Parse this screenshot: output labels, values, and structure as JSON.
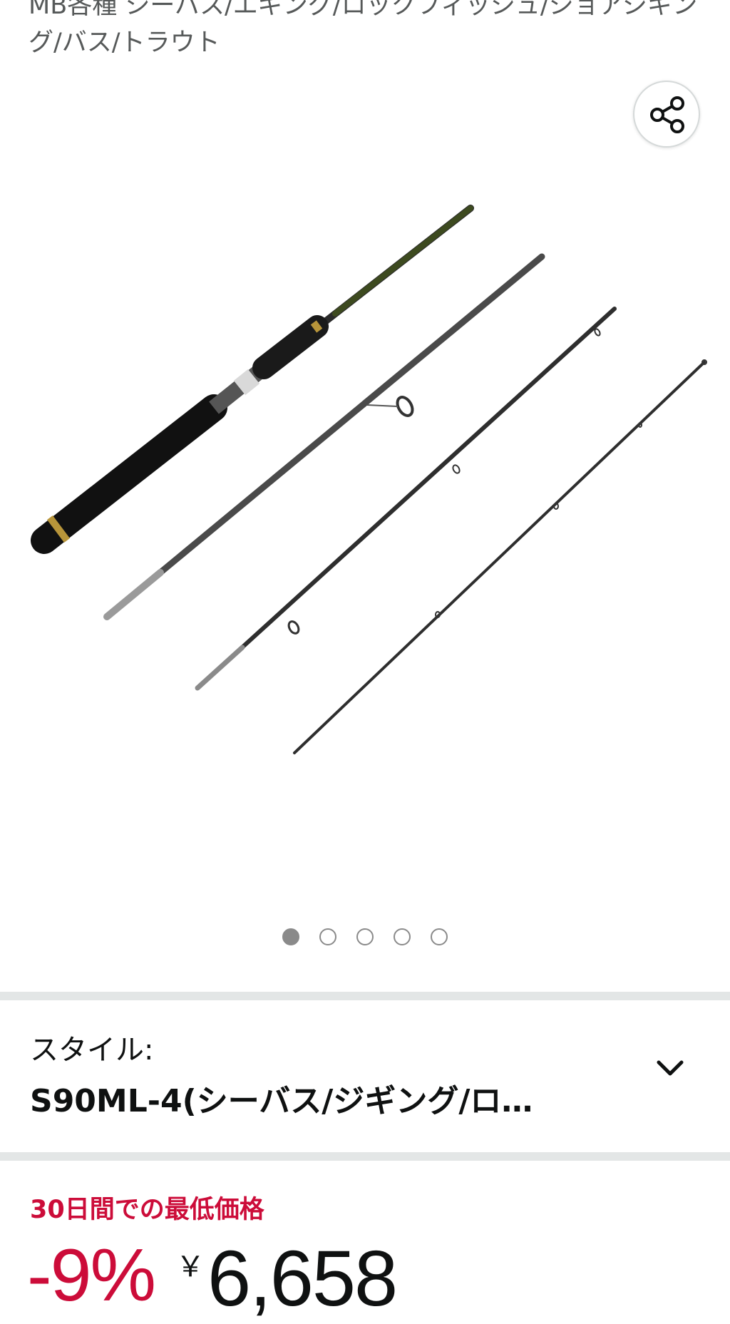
{
  "product": {
    "title": "MB各種 シーバス/エギング/ロックフィッシュ/ショアジギング/バス/トラウト"
  },
  "share": {
    "icon": "share-icon"
  },
  "gallery": {
    "image_count": 5,
    "active_index": 0
  },
  "style_selector": {
    "label": "スタイル:",
    "value": "S90ML-4(シーバス/ジギング/ロ…",
    "icon": "chevron-down-icon"
  },
  "pricing": {
    "deal_label": "30日間での最低価格",
    "discount": "-9%",
    "currency_symbol": "￥",
    "price": "6,658",
    "deal_color": "#cc0c39"
  }
}
